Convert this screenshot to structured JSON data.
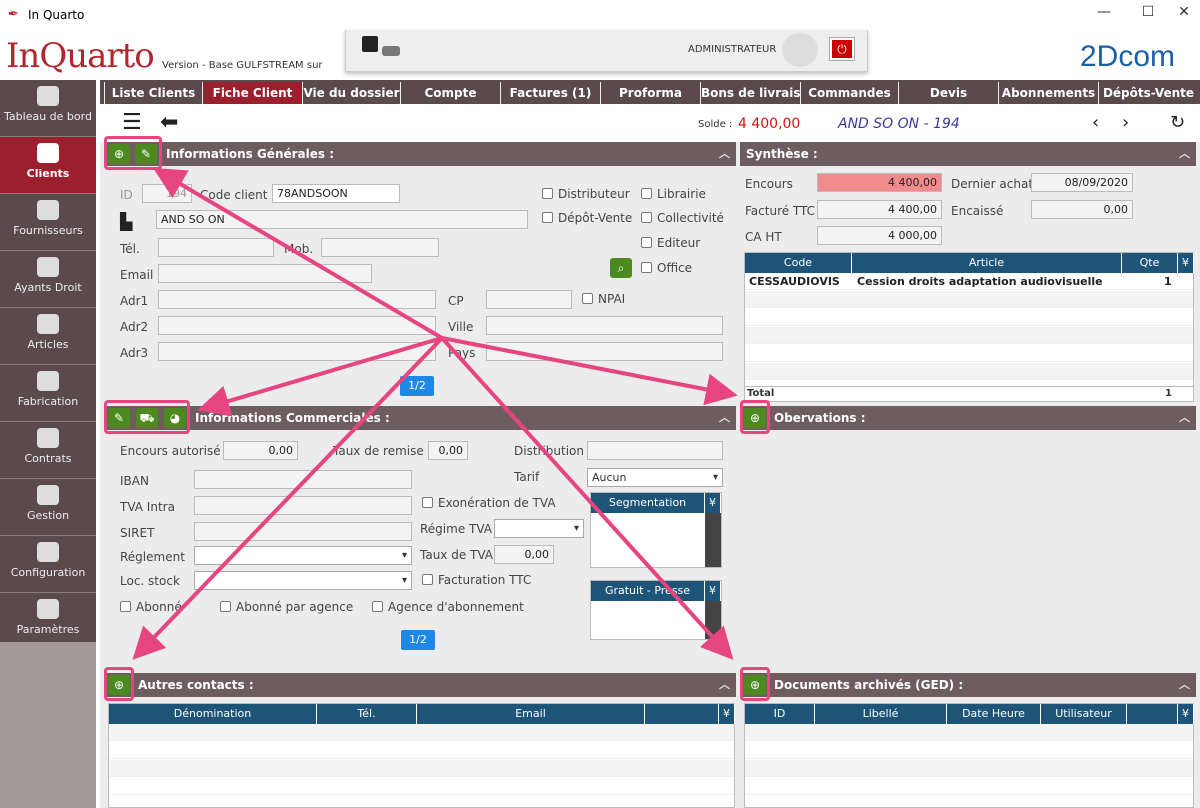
{
  "window": {
    "title": "In Quarto",
    "minimize": "—",
    "maximize": "☐",
    "close": "✕"
  },
  "header": {
    "logo_a": "In",
    "logo_b": "Quarto",
    "version": "Version  - Base GULFSTREAM sur",
    "user": "ADMINISTRATEUR",
    "brand": "2Dcom"
  },
  "sidebar": {
    "items": [
      {
        "label": "Tableau de bord",
        "icon": "shield-icon"
      },
      {
        "label": "Clients",
        "icon": "clients-icon"
      },
      {
        "label": "Fournisseurs",
        "icon": "suppliers-icon"
      },
      {
        "label": "Ayants Droit",
        "icon": "person-icon"
      },
      {
        "label": "Articles",
        "icon": "books-icon"
      },
      {
        "label": "Fabrication",
        "icon": "factory-icon"
      },
      {
        "label": "Contrats",
        "icon": "contract-icon"
      },
      {
        "label": "Gestion",
        "icon": "network-icon"
      },
      {
        "label": "Configuration",
        "icon": "sliders-icon"
      },
      {
        "label": "Paramètres",
        "icon": "gears-icon"
      }
    ]
  },
  "tabs": [
    "Liste Clients",
    "Fiche Client",
    "Vie du dossier",
    "Compte",
    "Factures (1)",
    "Proforma",
    "Bons de livraison",
    "Commandes",
    "Devis",
    "Abonnements",
    "Dépôts-Vente"
  ],
  "toolbar": {
    "solde_label": "Solde :",
    "solde_value": "4 400,00",
    "client": "AND SO ON - 194"
  },
  "general": {
    "title": "Informations Générales :",
    "id_label": "ID",
    "id_value": "194",
    "code_label": "Code client",
    "code_value": "78ANDSOON",
    "name_value": "AND SO ON",
    "tel_label": "Tél.",
    "mob_label": "Mob.",
    "email_label": "Email",
    "adr1": "Adr1",
    "adr2": "Adr2",
    "adr3": "Adr3",
    "cp": "CP",
    "ville": "Ville",
    "pays": "Pays",
    "npai": "NPAI",
    "checks": [
      "Distributeur",
      "Librairie",
      "Dépôt-Vente",
      "Collectivité",
      "Editeur",
      "Office"
    ],
    "pager": "1/2"
  },
  "synthese": {
    "title": "Synthèse :",
    "encours_label": "Encours",
    "encours_value": "4 400,00",
    "dernier_label": "Dernier achat",
    "dernier_value": "08/09/2020",
    "facture_label": "Facturé TTC",
    "facture_value": "4 400,00",
    "encaisse_label": "Encaissé",
    "encaisse_value": "0,00",
    "caht_label": "CA HT",
    "caht_value": "4 000,00",
    "cols": [
      "Code",
      "Article",
      "Qte"
    ],
    "rows": [
      {
        "code": "CESSAUDIOVIS",
        "article": "Cession droits adaptation audiovisuelle",
        "qte": "1"
      }
    ],
    "total_label": "Total",
    "total_value": "1"
  },
  "commercial": {
    "title": "Informations Commerciales :",
    "encours_label": "Encours autorisé",
    "encours_value": "0,00",
    "remise_label": "Taux de remise",
    "remise_value": "0,00",
    "distribution_label": "Distribution",
    "tarif_label": "Tarif",
    "tarif_value": "Aucun",
    "iban": "IBAN",
    "tva_intra": "TVA Intra",
    "siret": "SIRET",
    "reglement": "Réglement",
    "loc_stock": "Loc. stock",
    "exo_tva": "Exonération de TVA",
    "regime_tva": "Régime TVA",
    "taux_tva_label": "Taux de TVA",
    "taux_tva_value": "0,00",
    "facturation_ttc": "Facturation TTC",
    "abonne": "Abonné",
    "abonne_agence": "Abonné par agence",
    "agence_abonnement": "Agence d'abonnement",
    "segmentation": "Segmentation",
    "gratuit": "Gratuit - Presse",
    "pager": "1/2"
  },
  "observations": {
    "title": "Obervations :"
  },
  "contacts": {
    "title": "Autres contacts :",
    "cols": [
      "Dénomination",
      "Tél.",
      "Email"
    ]
  },
  "ged": {
    "title": "Documents archivés (GED) :",
    "cols": [
      "ID",
      "Libellé",
      "Date Heure",
      "Utilisateur"
    ]
  },
  "colors": {
    "sidebar": "#5a4a4d",
    "active": "#9c1f2d",
    "panel": "#6e5d60",
    "green": "#4b8a1f",
    "highlight": "#e6457f",
    "grid_head": "#1e5478"
  }
}
